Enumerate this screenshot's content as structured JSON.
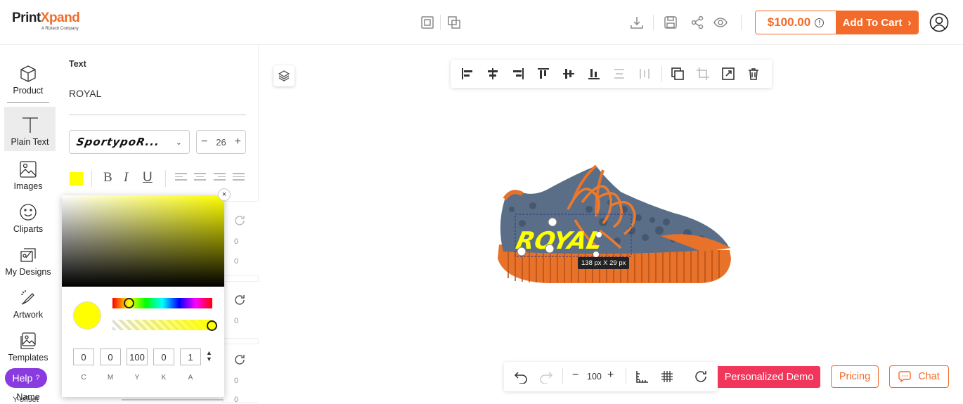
{
  "brand": {
    "name_part1": "Print",
    "name_part2": "Xpand",
    "tagline": "A Riztech Company"
  },
  "header": {
    "price": "$100.00",
    "add_to_cart": "Add To Cart"
  },
  "nav": {
    "items": [
      {
        "label": "Product",
        "icon": "cube-icon"
      },
      {
        "label": "Plain Text",
        "icon": "text-icon"
      },
      {
        "label": "Images",
        "icon": "image-icon"
      },
      {
        "label": "Cliparts",
        "icon": "smiley-icon"
      },
      {
        "label": "My Designs",
        "icon": "designs-icon"
      },
      {
        "label": "Artwork",
        "icon": "artwork-icon"
      },
      {
        "label": "Templates",
        "icon": "templates-icon"
      }
    ],
    "help_label": "Help",
    "help_mark": "?",
    "name_label": "Name"
  },
  "panel": {
    "title": "Text",
    "text_value": "ROYAL",
    "font_name": "SportypoR...",
    "font_size": "26",
    "bold": "B",
    "italic": "I",
    "underline": "U",
    "color": "#ffff00",
    "ghost_zeros": [
      "0",
      "0",
      "0",
      "0",
      "0"
    ],
    "y_offset_label": "Y-offset"
  },
  "color_picker": {
    "close": "×",
    "fields": [
      {
        "label": "C",
        "value": "0"
      },
      {
        "label": "M",
        "value": "0"
      },
      {
        "label": "Y",
        "value": "100"
      },
      {
        "label": "K",
        "value": "0"
      },
      {
        "label": "A",
        "value": "1"
      }
    ]
  },
  "canvas": {
    "design_text": "ROYAL",
    "dimensions": "138 px X 29 px"
  },
  "bottom": {
    "zoom": "100",
    "demo": "Personalized Demo",
    "pricing": "Pricing",
    "chat": "Chat"
  },
  "colors": {
    "accent": "#f26b2a",
    "demo": "#f0365a",
    "help": "#8a3be0",
    "selected_text": "#ffff00"
  }
}
